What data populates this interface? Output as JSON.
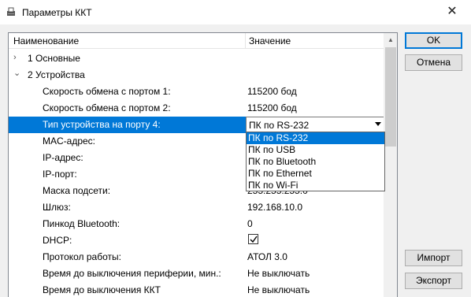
{
  "window": {
    "title": "Параметры ККТ",
    "close_glyph": "✕"
  },
  "grid": {
    "header": {
      "name": "Наименование",
      "value": "Значение"
    },
    "rows": [
      {
        "label": "1 Основные",
        "value": "",
        "expander": "›"
      },
      {
        "label": "2 Устройства",
        "value": "",
        "expander": "⌄"
      },
      {
        "label": "Скорость обмена с портом 1:",
        "value": "115200 бод"
      },
      {
        "label": "Скорость обмена с портом 2:",
        "value": "115200 бод"
      },
      {
        "label": "Тип устройства на порту 4:",
        "value": "ПК по RS-232"
      },
      {
        "label": "MAC-адрес:",
        "value": ""
      },
      {
        "label": "IP-адрес:",
        "value": ""
      },
      {
        "label": "IP-порт:",
        "value": ""
      },
      {
        "label": "Маска подсети:",
        "value": "255.255.255.0"
      },
      {
        "label": "Шлюз:",
        "value": "192.168.10.0"
      },
      {
        "label": "Пинкод Bluetooth:",
        "value": "0"
      },
      {
        "label": "DHCP:",
        "value": "",
        "checked": true
      },
      {
        "label": "Протокол работы:",
        "value": "АТОЛ 3.0"
      },
      {
        "label": "Время до выключения периферии, мин.:",
        "value": "Не выключать"
      },
      {
        "label": "Время до выключения ККТ",
        "value": "Не выключать"
      }
    ]
  },
  "dropdown": {
    "options": [
      "ПК по RS-232",
      "ПК по USB",
      "ПК по Bluetooth",
      "ПК по Ethernet",
      "ПК по Wi-Fi"
    ],
    "highlighted_index": 0
  },
  "buttons": {
    "ok": "OK",
    "cancel": "Отмена",
    "import": "Импорт",
    "export": "Экспорт"
  },
  "colors": {
    "selection": "#0078d7",
    "background": "#f0f0f0"
  }
}
